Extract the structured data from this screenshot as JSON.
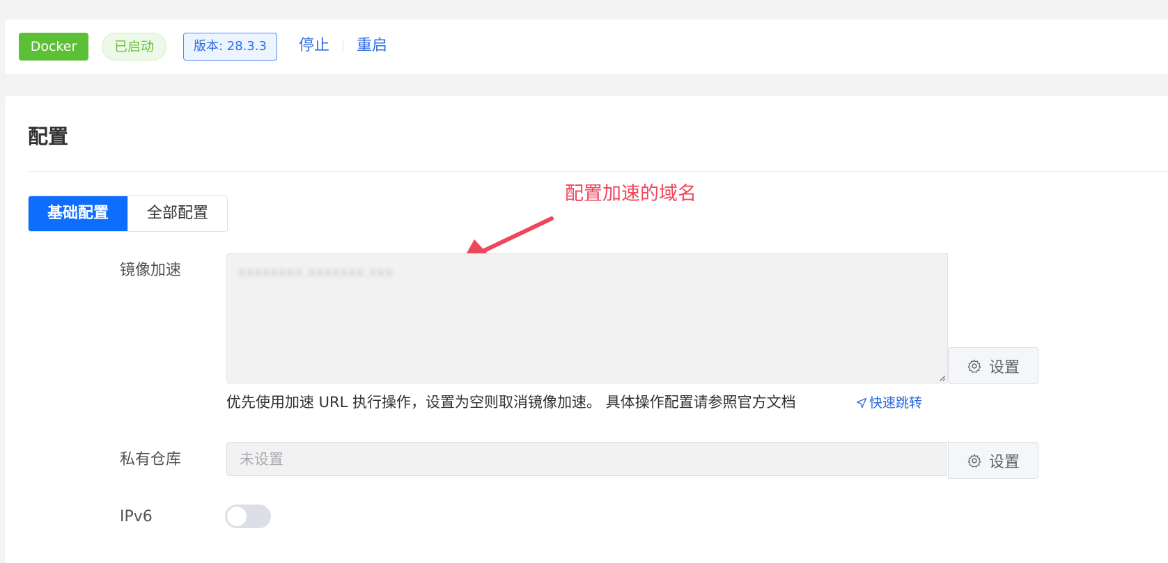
{
  "status_bar": {
    "app_badge": "Docker",
    "state_badge": "已启动",
    "version_badge": "版本: 28.3.3",
    "stop_label": "停止",
    "restart_label": "重启"
  },
  "config": {
    "title": "配置",
    "tabs": [
      {
        "label": "基础配置",
        "active": true
      },
      {
        "label": "全部配置",
        "active": false
      }
    ],
    "annotation": "配置加速的域名",
    "mirror": {
      "label": "镜像加速",
      "value": "xxxxxxxx.xxxxxxx.xxx",
      "set_button": "设置",
      "hint": "优先使用加速 URL 执行操作，设置为空则取消镜像加速。 具体操作配置请参照官方文档",
      "quick_link": "快速跳转"
    },
    "private_registry": {
      "label": "私有仓库",
      "placeholder": "未设置",
      "set_button": "设置"
    },
    "ipv6": {
      "label": "IPv6",
      "enabled": false
    }
  },
  "colors": {
    "primary": "#0d6efd",
    "success": "#5cc037",
    "link": "#2c6be0",
    "annotation": "#f0465b"
  }
}
